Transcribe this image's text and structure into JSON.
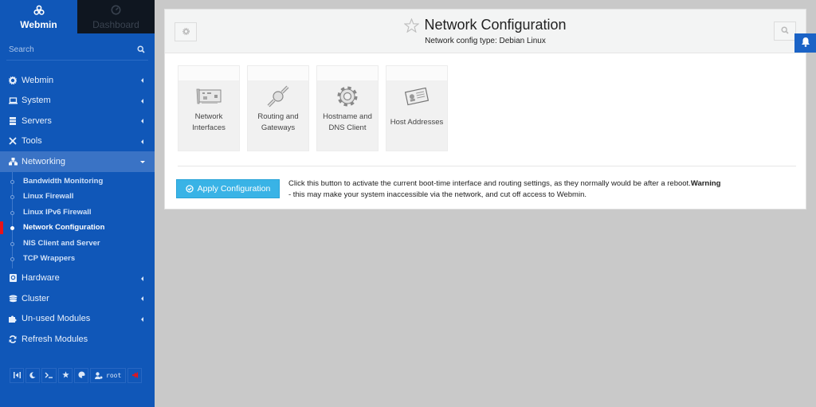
{
  "sidebar": {
    "tabs": [
      {
        "label": "Webmin",
        "icon": "webmin-logo-icon",
        "active": true
      },
      {
        "label": "Dashboard",
        "icon": "dashboard-gauge-icon",
        "active": false
      }
    ],
    "search": {
      "placeholder": "Search",
      "value": ""
    },
    "menu": [
      {
        "label": "Webmin",
        "icon": "gear-icon"
      },
      {
        "label": "System",
        "icon": "laptop-icon"
      },
      {
        "label": "Servers",
        "icon": "server-icon"
      },
      {
        "label": "Tools",
        "icon": "tools-icon"
      },
      {
        "label": "Networking",
        "icon": "network-icon",
        "open": true
      }
    ],
    "networking_items": [
      {
        "label": "Bandwidth Monitoring"
      },
      {
        "label": "Linux Firewall"
      },
      {
        "label": "Linux IPv6 Firewall"
      },
      {
        "label": "Network Configuration",
        "active": true
      },
      {
        "label": "NIS Client and Server"
      },
      {
        "label": "TCP Wrappers"
      }
    ],
    "menu_after": [
      {
        "label": "Hardware",
        "icon": "hdd-icon"
      },
      {
        "label": "Cluster",
        "icon": "layers-icon"
      },
      {
        "label": "Un-used Modules",
        "icon": "puzzle-icon"
      },
      {
        "label": "Refresh Modules",
        "icon": "refresh-icon"
      }
    ],
    "bottom_bar": {
      "user_label": "root"
    }
  },
  "panel": {
    "title": "Network Configuration",
    "subtitle": "Network config type: Debian Linux",
    "modules": [
      {
        "line1": "Network",
        "line2": "Interfaces",
        "icon": "network-card-icon"
      },
      {
        "line1": "Routing and",
        "line2": "Gateways",
        "icon": "cable-connector-icon"
      },
      {
        "line1": "Hostname and",
        "line2": "DNS Client",
        "icon": "cog-icon"
      },
      {
        "line1": "Host Addresses",
        "line2": "",
        "icon": "address-card-icon"
      }
    ],
    "apply": {
      "button_label": "Apply Configuration",
      "desc_part1": "Click this button to activate the current boot-time interface and routing settings, as they normally would be after a reboot.",
      "desc_warning": "Warning",
      "desc_part2": " - this may make your system inaccessible via the network, and cut off access to Webmin."
    }
  },
  "colors": {
    "sidebar_bg": "#1057b8",
    "active_marker": "#e8131a",
    "apply_button": "#39b3e6",
    "page_bg": "#c9c9c9"
  }
}
